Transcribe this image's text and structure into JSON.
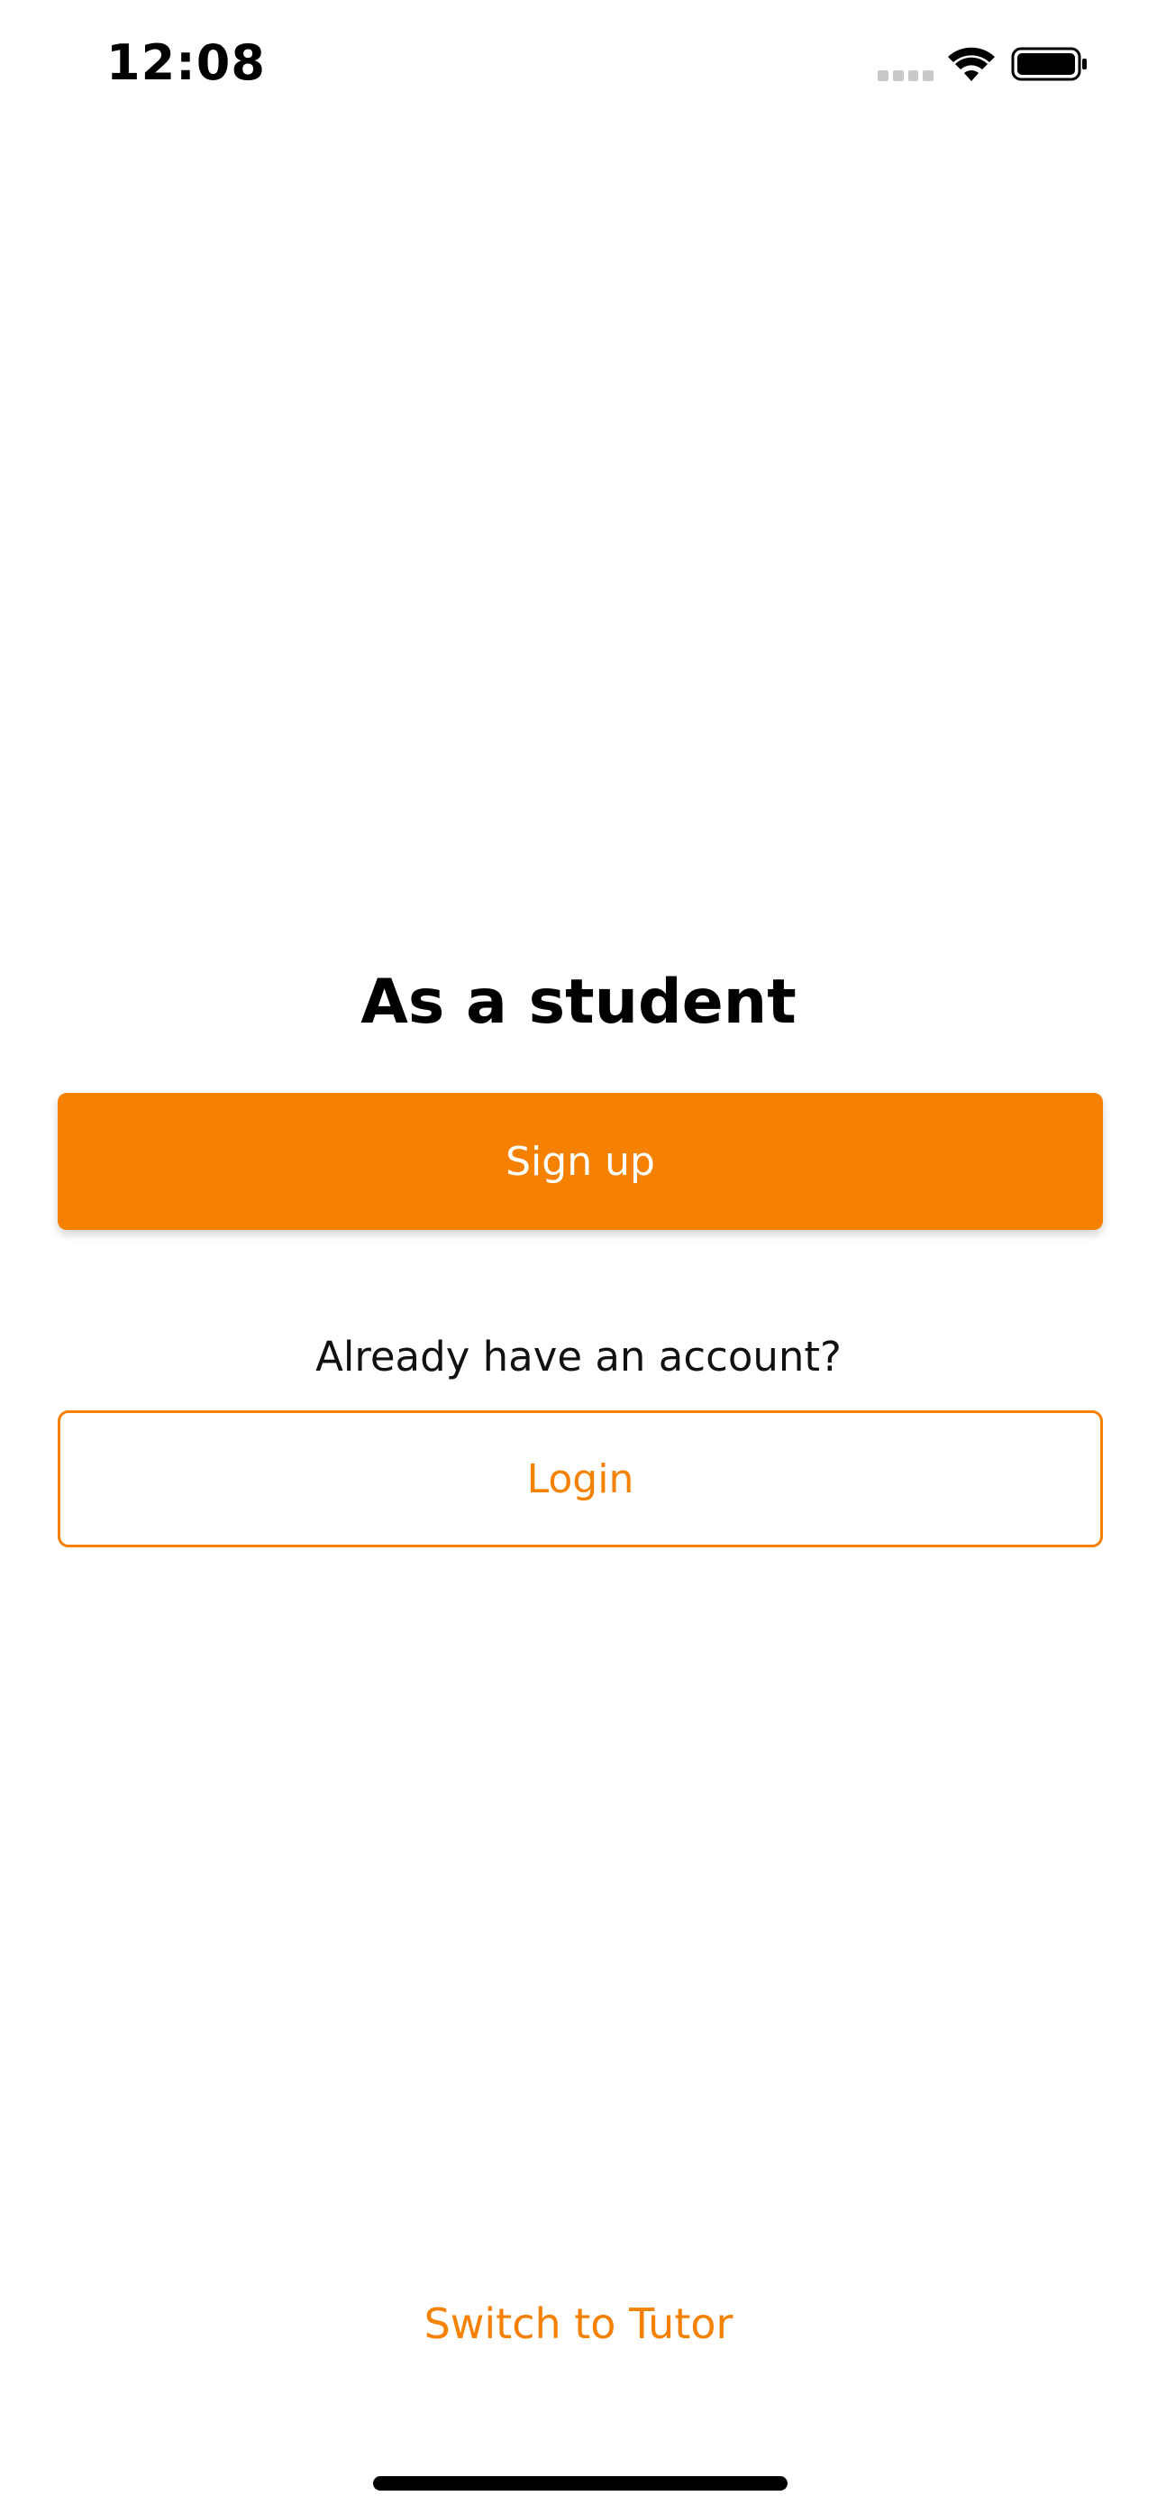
{
  "status_bar": {
    "time": "12:08",
    "icons": [
      "signal-icon",
      "wifi-icon",
      "battery-icon"
    ]
  },
  "main": {
    "title": "As a student",
    "signup_label": "Sign up",
    "account_prompt": "Already have an account?",
    "login_label": "Login",
    "switch_label": "Switch to Tutor"
  },
  "colors": {
    "accent": "#f68100",
    "background": "#ffffff",
    "text": "#000000"
  }
}
